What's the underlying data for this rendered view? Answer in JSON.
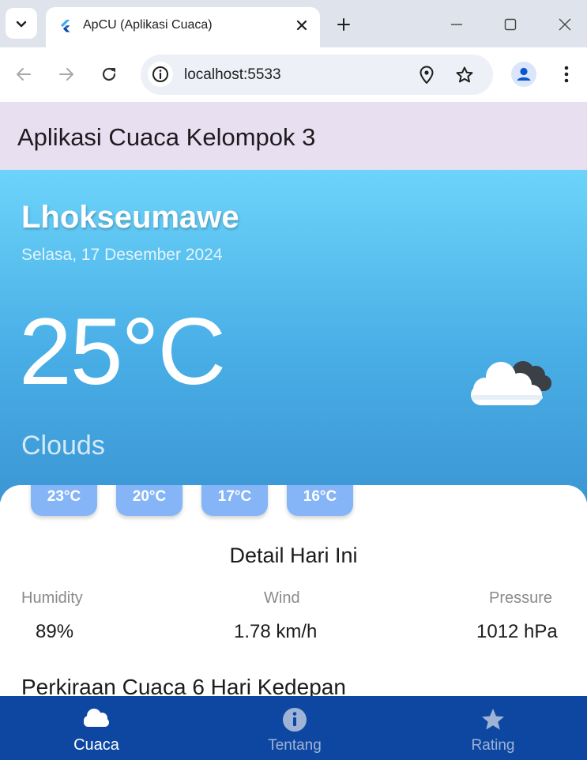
{
  "browser": {
    "tab_title": "ApCU (Aplikasi Cuaca)",
    "url": "localhost:5533"
  },
  "app": {
    "title": "Aplikasi Cuaca Kelompok 3"
  },
  "weather": {
    "city": "Lhokseumawe",
    "date": "Selasa, 17 Desember 2024",
    "temperature": "25°C",
    "condition": "Clouds",
    "icon": "cloud-icon"
  },
  "hourly": [
    "23°C",
    "20°C",
    "17°C",
    "16°C"
  ],
  "details": {
    "title": "Detail Hari Ini",
    "humidity": {
      "label": "Humidity",
      "value": "89%"
    },
    "wind": {
      "label": "Wind",
      "value": "1.78 km/h"
    },
    "pressure": {
      "label": "Pressure",
      "value": "1012 hPa"
    }
  },
  "forecast": {
    "title": "Perkiraan Cuaca 6 Hari Kedepan"
  },
  "bottom_nav": {
    "items": [
      {
        "label": "Cuaca",
        "icon": "cloud-icon",
        "active": true
      },
      {
        "label": "Tentang",
        "icon": "info-icon",
        "active": false
      },
      {
        "label": "Rating",
        "icon": "star-icon",
        "active": false
      }
    ]
  },
  "colors": {
    "appbar": "#e8e0f0",
    "hero_top": "#6cd4fa",
    "hero_bottom": "#3b97d4",
    "chip": "#86b5f7",
    "bottom_nav": "#0d47a1"
  }
}
